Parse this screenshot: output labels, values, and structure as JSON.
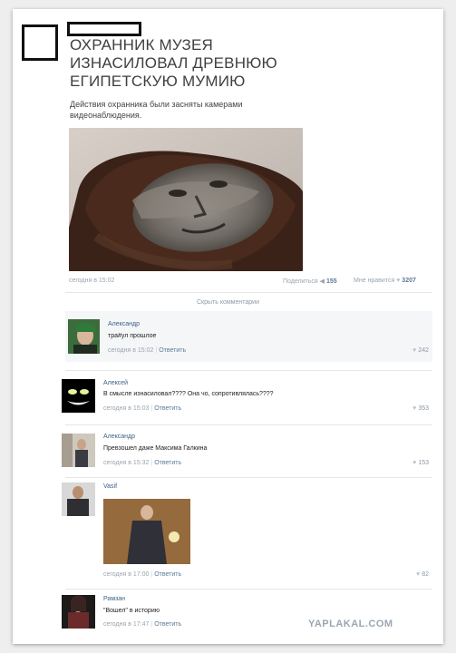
{
  "post": {
    "title_lines": [
      "Охранник музея",
      "изнасиловал древнюю",
      "египетскую мумию"
    ],
    "subtitle": "Действия охранника были засняты камерами видеонаблюдения.",
    "time": "сегодня в 15:02",
    "share_label": "Поделиться",
    "share_count": "155",
    "like_label": "Мне нравится",
    "like_count": "3207"
  },
  "hide_comments": "Скрыть комментарии",
  "comments": [
    {
      "author": "Александр",
      "text": "тра#ул прошлое",
      "time": "сегодня в 15:02",
      "reply": "Ответить",
      "likes": "242"
    },
    {
      "author": "Алексей",
      "text": "В смысле изнасиловал???? Она чо, сопротивлялась????",
      "time": "сегодня в 15:03",
      "reply": "Ответить",
      "likes": "353"
    },
    {
      "author": "Александр",
      "text": "Превзошел даже Максима Галкина",
      "time": "сегодня в 15:32",
      "reply": "Ответить",
      "likes": "153"
    },
    {
      "author": "Vasif",
      "text": "",
      "time": "сегодня в 17:00",
      "reply": "Ответить",
      "likes": "82"
    },
    {
      "author": "Рамзан",
      "text": "\"Вошел\" в историю",
      "time": "сегодня в 17:47",
      "reply": "Ответить",
      "likes": ""
    }
  ],
  "watermark": "YAPLAKAL.COM",
  "icons": {
    "like": "heart-icon",
    "share": "megaphone-icon"
  }
}
